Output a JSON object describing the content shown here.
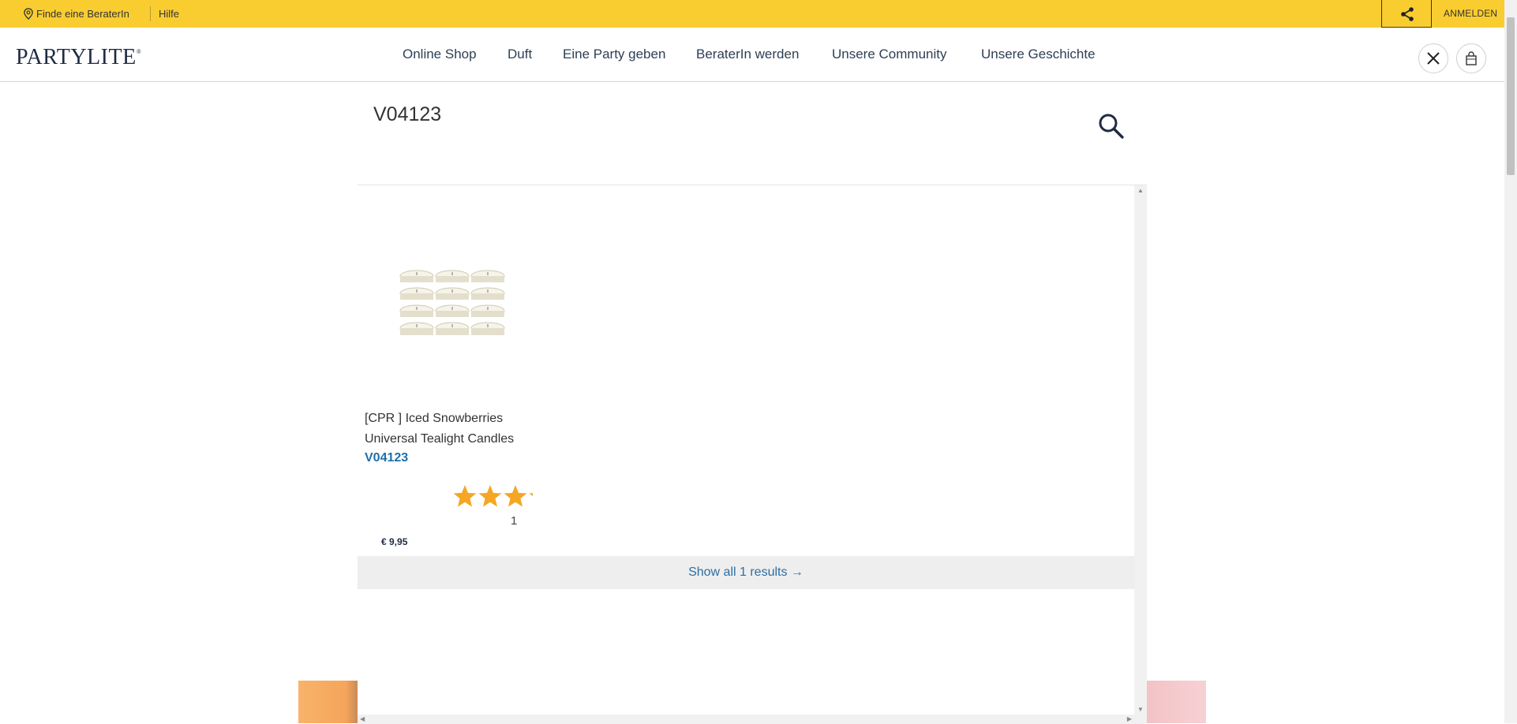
{
  "topbar": {
    "find_consultant": "Finde eine BeraterIn",
    "help": "Hilfe",
    "login": "ANMELDEN"
  },
  "header": {
    "logo_text": "PARTYLITE",
    "nav": [
      "Online Shop",
      "Duft",
      "Eine Party geben",
      "BeraterIn werden",
      "Unsere Community",
      "Unsere Geschichte"
    ]
  },
  "search": {
    "value": "V04123"
  },
  "results": {
    "items": [
      {
        "title": "[CPR ] Iced Snowberries Universal Tealight Candles",
        "sku": "V04123",
        "rating": 3.5,
        "review_count": "1",
        "price": "€ 9,95"
      }
    ],
    "show_all": "Show all 1 results →"
  },
  "colors": {
    "topbar": "#f9cd30",
    "sku_link": "#1f6eaa",
    "star": "#f5a623"
  }
}
